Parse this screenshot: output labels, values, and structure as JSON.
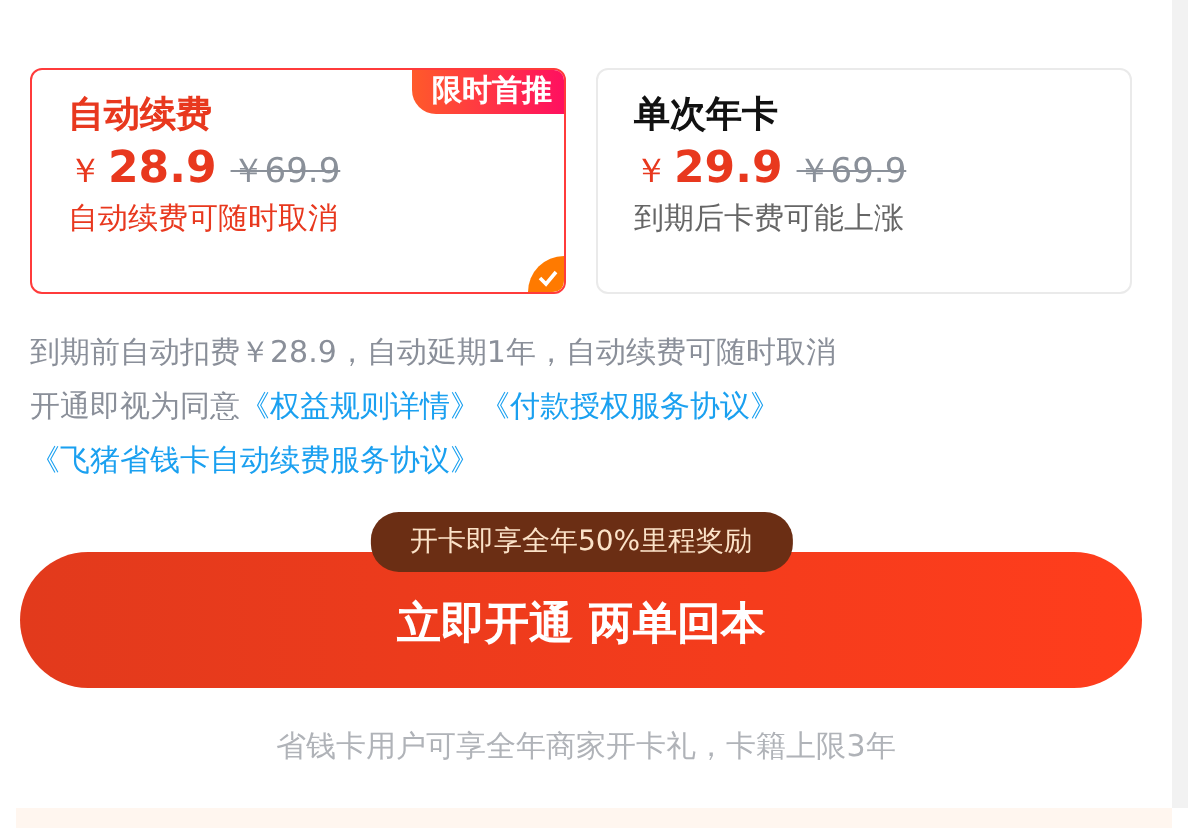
{
  "plans": [
    {
      "title": "自动续费",
      "badge": "限时首推",
      "currency": "￥",
      "price": "28.9",
      "original_price": "￥69.9",
      "note": "自动续费可随时取消",
      "selected": true
    },
    {
      "title": "单次年卡",
      "currency": "￥",
      "price": "29.9",
      "original_price": "￥69.9",
      "note": "到期后卡费可能上涨",
      "selected": false
    }
  ],
  "terms": {
    "text": "到期前自动扣费￥28.9，自动延期1年，自动续费可随时取消",
    "agree_prefix": "开通即视为同意",
    "links": [
      "《权益规则详情》",
      "《付款授权服务协议》",
      "《飞猪省钱卡自动续费服务协议》"
    ]
  },
  "promo_badge": "开卡即享全年50%里程奖励",
  "cta_button": "立即开通 两单回本",
  "footer_note": "省钱卡用户可享全年商家开卡礼，卡籍上限3年"
}
